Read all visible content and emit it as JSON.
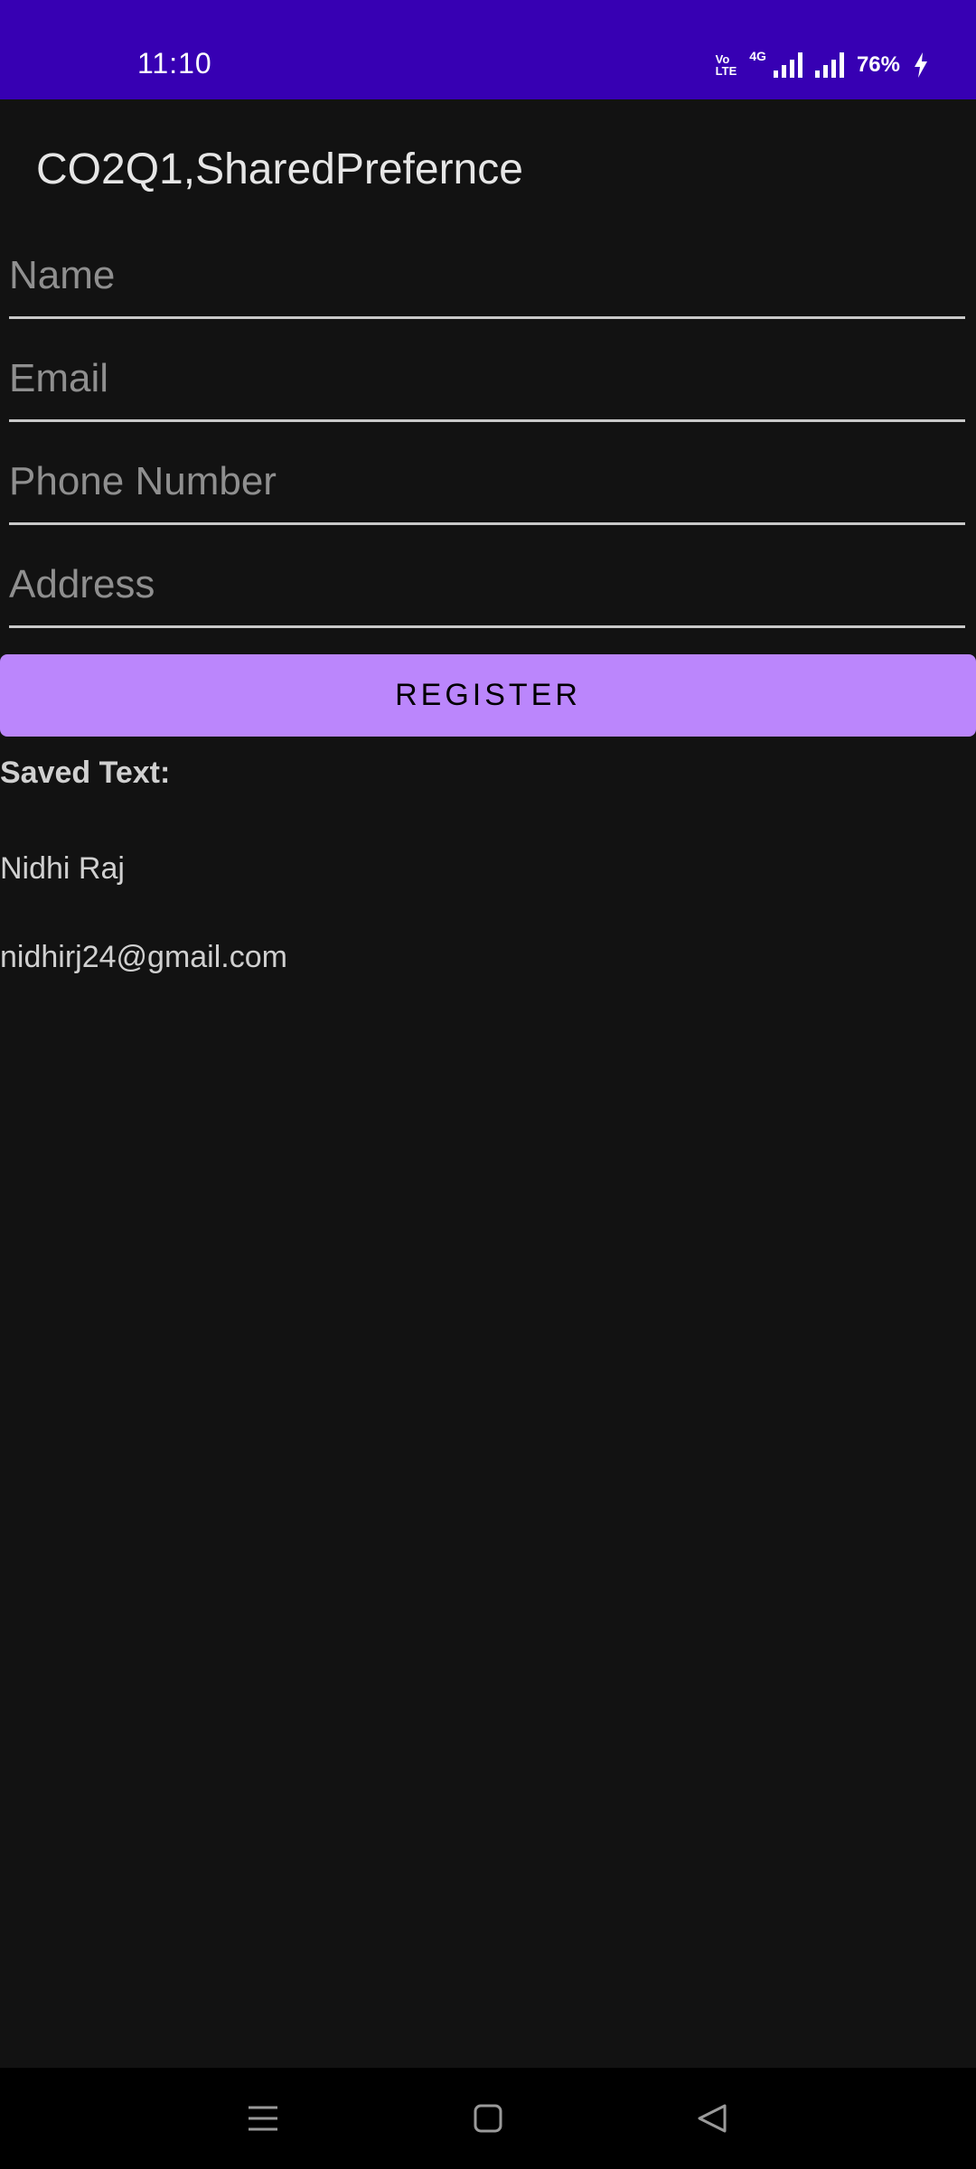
{
  "status_bar": {
    "time": "11:10",
    "volte_top": "Vo",
    "volte_bottom": "LTE",
    "network": "4G",
    "battery": "76%"
  },
  "app_bar": {
    "title": "CO2Q1,SharedPrefernce"
  },
  "form": {
    "name_placeholder": "Name",
    "email_placeholder": "Email",
    "phone_placeholder": "Phone Number",
    "address_placeholder": "Address",
    "register_label": "REGISTER"
  },
  "saved": {
    "label": "Saved Text:",
    "name": "Nidhi Raj",
    "email": "nidhirj24@gmail.com"
  },
  "colors": {
    "status_bar": "#3700b3",
    "background": "#121212",
    "button": "#bb86fc"
  },
  "icons": [
    "signal-icon",
    "charging-icon",
    "recents-icon",
    "home-icon",
    "back-icon"
  ]
}
